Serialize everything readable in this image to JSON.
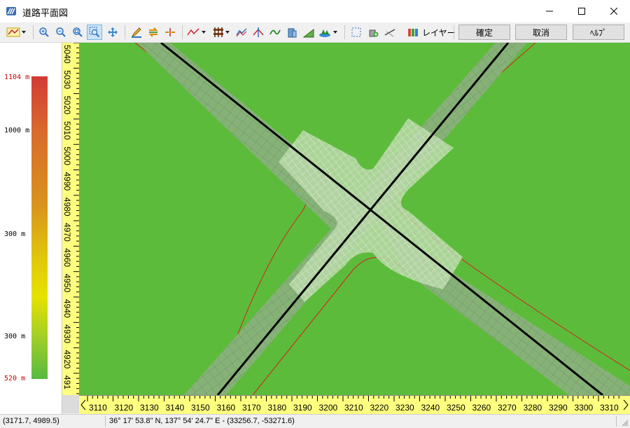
{
  "window": {
    "title": "道路平面図",
    "app_icon": "road-plan-icon",
    "controls": [
      "minimize-icon",
      "maximize-icon",
      "close-icon"
    ]
  },
  "toolbar": {
    "icons": [
      "polyline-dropdown-icon",
      "zoom-in-icon",
      "zoom-out-icon",
      "zoom-fit-icon",
      "zoom-window-icon",
      "pan-icon",
      "draw-edit-icon",
      "swap-icon",
      "split-line-icon",
      "profile-line-dropdown-icon",
      "railway-dropdown-icon",
      "line-tool-icon",
      "cross-line-icon",
      "curve-icon",
      "building-icon",
      "slope-icon",
      "terrain-dropdown-icon",
      "select-rect-icon",
      "add-object-icon",
      "measure-icon",
      "layer-icon"
    ],
    "layer_label": "レイヤー",
    "confirm_label": "確定",
    "cancel_label": "取消",
    "help_label": "ﾍﾙﾌﾟ"
  },
  "legend": {
    "labels": [
      {
        "text": "1104 m",
        "color": "#cc0000"
      },
      {
        "text": "1000 m",
        "color": "#000000"
      },
      {
        "text": "300 m",
        "color": "#000000"
      },
      {
        "text": "300 m",
        "color": "#000000"
      },
      {
        "text": "520 m",
        "color": "#cc0000"
      }
    ],
    "gradient_colors": [
      "#d23a35",
      "#d9921c",
      "#e6e200",
      "#57ba41"
    ]
  },
  "rulers": {
    "x_ticks": [
      "3110",
      "3120",
      "3130",
      "3140",
      "3150",
      "3160",
      "3170",
      "3180",
      "3190",
      "3200",
      "3210",
      "3220",
      "3230",
      "3240",
      "3250",
      "3260",
      "3270",
      "3280",
      "3290",
      "3300",
      "3310"
    ],
    "y_ticks": [
      "5040",
      "5030",
      "5020",
      "5010",
      "5000",
      "4990",
      "4980",
      "4970",
      "4960",
      "4950",
      "4940",
      "4930",
      "4920",
      "491"
    ]
  },
  "map": {
    "background_color": "#5dbb3b",
    "boundary_color": "#d42020",
    "centerline_color": "#000000",
    "pavement_color": "#b8d8a8"
  },
  "status": {
    "local_coords": "(3171.7, 4989.5)",
    "geo_coords": "36° 17' 53.8\" N, 137° 54' 24.7\" E  -  (33256.7, -53271.6)"
  }
}
